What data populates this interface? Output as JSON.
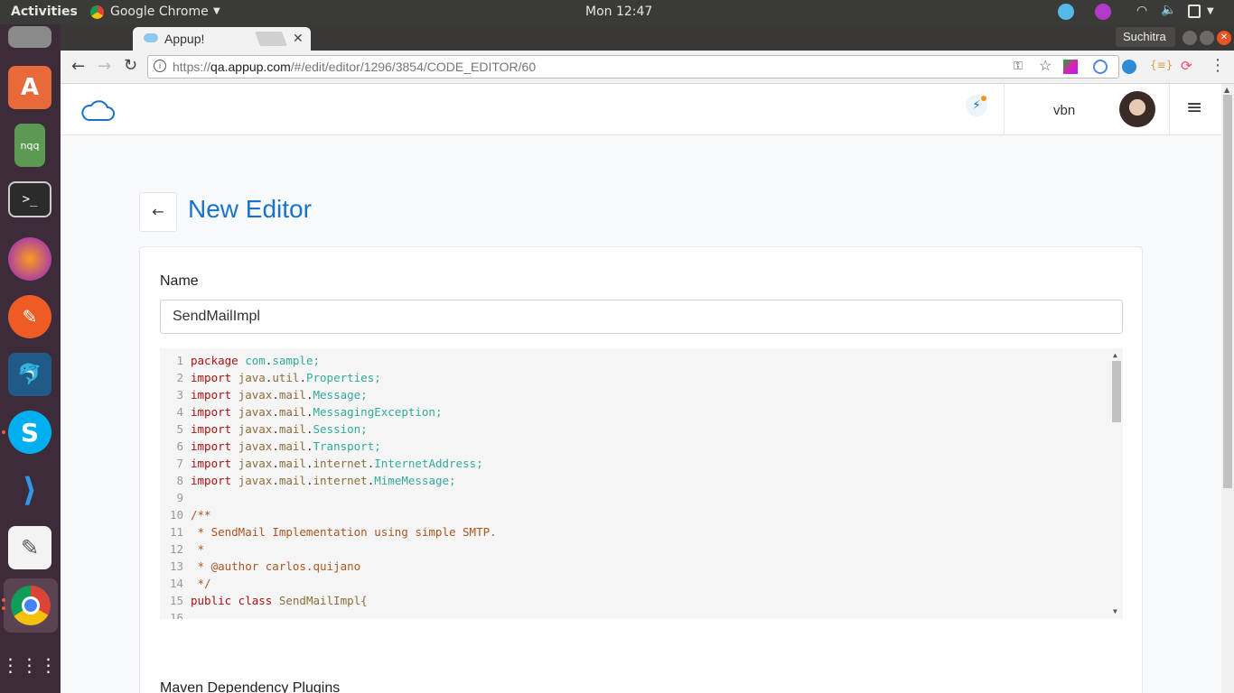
{
  "os": {
    "activities": "Activities",
    "app_name": "Google Chrome",
    "clock": "Mon 12:47"
  },
  "browser": {
    "tab_title": "Appup!",
    "profile": "Suchitra",
    "url_prefix": "https://",
    "url_host": "qa.appup.com",
    "url_path": "/#/edit/editor/1296/3854/CODE_EDITOR/60"
  },
  "app": {
    "user": "vbn",
    "page_title": "New Editor",
    "name_label": "Name",
    "name_value": "SendMailImpl",
    "next_section": "Maven Dependency Plugins"
  },
  "dock": {
    "items": [
      "nqq"
    ]
  },
  "code": {
    "line_numbers": [
      "1",
      "2",
      "3",
      "4",
      "5",
      "6",
      "7",
      "8",
      "9",
      "10",
      "11",
      "12",
      "13",
      "14",
      "15",
      "16"
    ],
    "lines": [
      "package com.sample;",
      "import java.util.Properties;",
      "import javax.mail.Message;",
      "import javax.mail.MessagingException;",
      "import javax.mail.Session;",
      "import javax.mail.Transport;",
      "import javax.mail.internet.InternetAddress;",
      "import javax.mail.internet.MimeMessage;",
      "",
      "/**",
      " * SendMail Implementation using simple SMTP.",
      " *",
      " * @author carlos.quijano",
      " */",
      "public class SendMailImpl{",
      ""
    ]
  }
}
